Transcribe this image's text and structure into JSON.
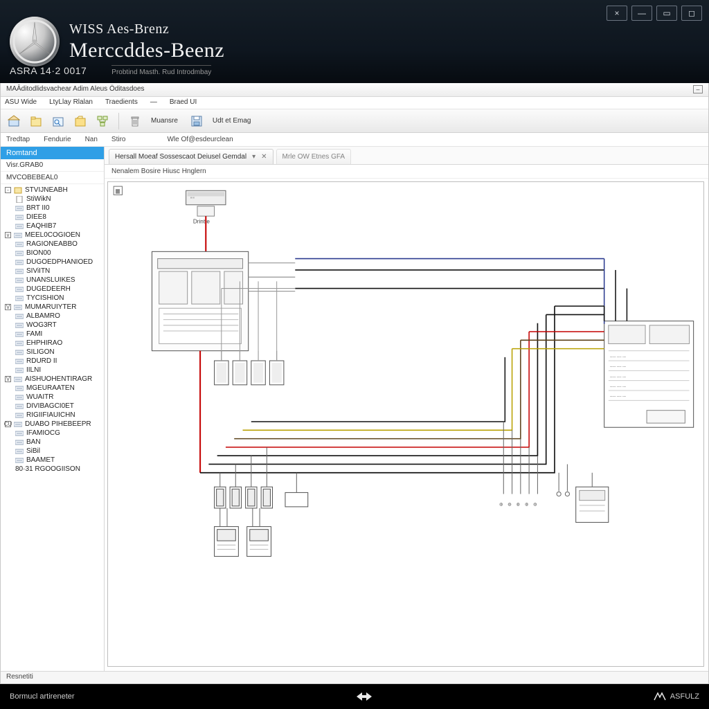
{
  "banner": {
    "brand_small": "WISS Aes-Brenz",
    "brand_big": "Merccddes-Beenz",
    "code": "ASRA 14·2 0017",
    "product": "Probtind Masth. Rud Introdmbay"
  },
  "titlebar": {
    "text": "MAĀditodlidsvachear Adim Aleus Öditasdoes"
  },
  "menubar": [
    "ASU Wide",
    "LtyLlay Rlalan",
    "Traedients",
    "—",
    "Braed UI"
  ],
  "toolbar_labels": {
    "a": "Muansre",
    "b": "Udt et Emag"
  },
  "subtoolbar": [
    "Tredtap",
    "Fendurie",
    "Nan",
    "Stiro",
    "Wle Of@esdeurclean"
  ],
  "sidebar": {
    "head": "Romtand",
    "sub1": "Visr.GRAB0",
    "sub2": "MVCOBEBEAL0",
    "items": [
      {
        "toggle": "-",
        "icon": "box",
        "label": "STVIJNEABH"
      },
      {
        "toggle": "",
        "icon": "doc",
        "label": "StiWikN"
      },
      {
        "toggle": "",
        "icon": "row",
        "label": "BRT II0"
      },
      {
        "toggle": "",
        "icon": "row",
        "label": "DIEE8"
      },
      {
        "toggle": "",
        "icon": "row",
        "label": "EAQHIB7"
      },
      {
        "toggle": "v",
        "icon": "row",
        "label": "MEEL0COGIOEN"
      },
      {
        "toggle": "",
        "icon": "row",
        "label": "RAGIONEABBO"
      },
      {
        "toggle": "",
        "icon": "row",
        "label": "BION00"
      },
      {
        "toggle": "",
        "icon": "row",
        "label": "DUGOEDPHANIOED"
      },
      {
        "toggle": "",
        "icon": "row",
        "label": "SIViITN"
      },
      {
        "toggle": "",
        "icon": "row",
        "label": "UNANSLUIKES"
      },
      {
        "toggle": "",
        "icon": "row",
        "label": "DUGEDEERH"
      },
      {
        "toggle": "",
        "icon": "row",
        "label": "TYCISHION"
      },
      {
        "toggle": "V",
        "icon": "row",
        "label": "MUMARUIYTER"
      },
      {
        "toggle": "",
        "icon": "row",
        "label": "ALBAMRO"
      },
      {
        "toggle": "",
        "icon": "row",
        "label": "WOG3RT"
      },
      {
        "toggle": "",
        "icon": "row",
        "label": "FAMI"
      },
      {
        "toggle": "",
        "icon": "row",
        "label": "EHPHIRAO"
      },
      {
        "toggle": "",
        "icon": "row",
        "label": "SILIGON"
      },
      {
        "toggle": "",
        "icon": "row",
        "label": "RDURD II"
      },
      {
        "toggle": "",
        "icon": "row",
        "label": "IILNI"
      },
      {
        "toggle": "V",
        "icon": "row",
        "label": "AISHUOHENTIRAGR"
      },
      {
        "toggle": "",
        "icon": "row",
        "label": "MGEURAATEN"
      },
      {
        "toggle": "",
        "icon": "row",
        "label": "WUAITR"
      },
      {
        "toggle": "",
        "icon": "row",
        "label": "DIVIBAGCI0ET"
      },
      {
        "toggle": "",
        "icon": "row",
        "label": "RIGIIFIAUICHN"
      },
      {
        "toggle": "CU",
        "icon": "row",
        "label": "DUABO PIHEBEEPR"
      },
      {
        "toggle": "",
        "icon": "row",
        "label": "IFAMIOCG"
      },
      {
        "toggle": "",
        "icon": "row",
        "label": "BAN"
      },
      {
        "toggle": "",
        "icon": "row",
        "label": "SiBil"
      },
      {
        "toggle": "",
        "icon": "row",
        "label": "BAAMET"
      },
      {
        "toggle": "",
        "icon": "",
        "label": "80·31 RGOOGIISON"
      }
    ]
  },
  "tabs": {
    "active": "Hersall Moeaf Sossescaot Deiusel Gemdal",
    "inactive": "Mrle OW Etnes GFA"
  },
  "crumb": "Nenalem Bosire Hiusc Hnglern",
  "status": "Resnetiti",
  "footer": {
    "left": "Bormucl artireneter",
    "right": "ASFULZ"
  },
  "diagram": {
    "ecu_label": "Drintte"
  }
}
